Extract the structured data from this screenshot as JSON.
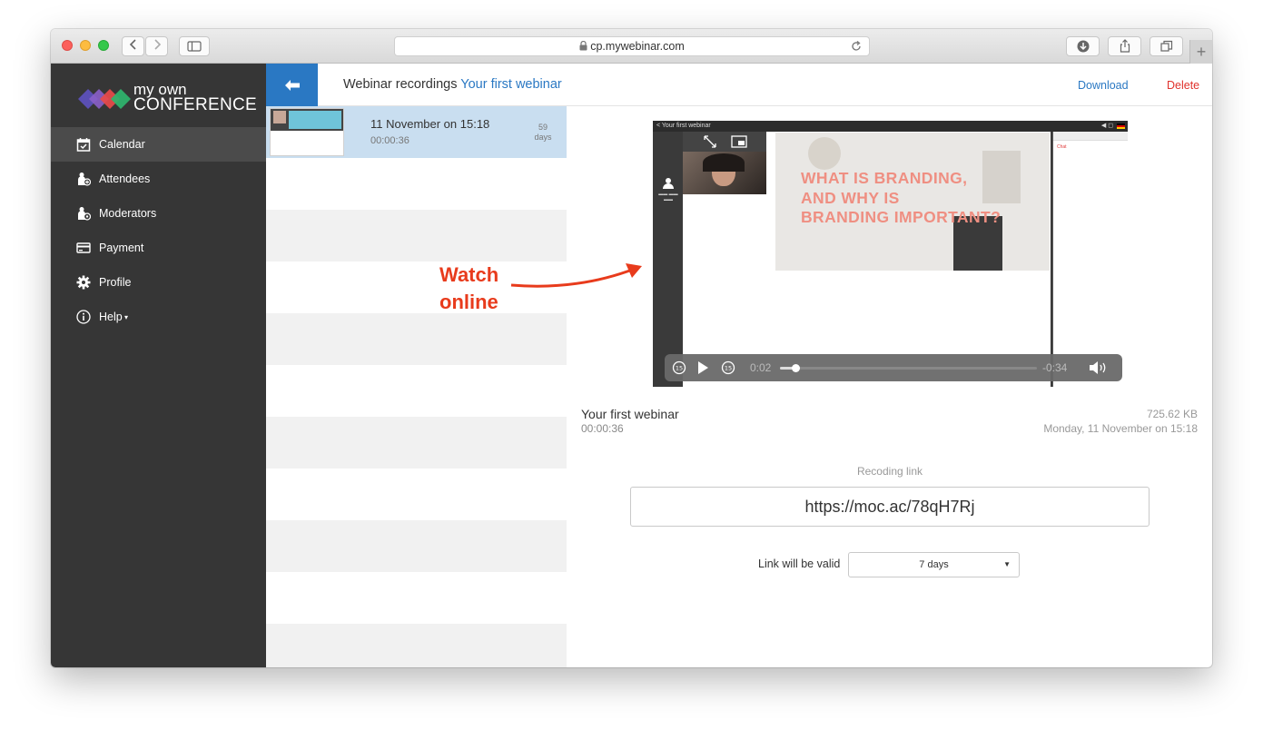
{
  "browser": {
    "url": "cp.mywebinar.com",
    "new_tab_glyph": "+"
  },
  "brand": {
    "line1": "my own",
    "line2": "CONFERENCE",
    "colors": [
      "#5a4fb3",
      "#8a5fc9",
      "#e84a4a",
      "#2fb56e"
    ]
  },
  "sidebar": {
    "items": [
      {
        "label": "Calendar",
        "icon": "calendar-check-icon",
        "active": true
      },
      {
        "label": "Attendees",
        "icon": "attendees-icon",
        "active": false
      },
      {
        "label": "Moderators",
        "icon": "moderator-icon",
        "active": false
      },
      {
        "label": "Payment",
        "icon": "credit-card-icon",
        "active": false
      },
      {
        "label": "Profile",
        "icon": "gear-icon",
        "active": false
      },
      {
        "label": "Help",
        "icon": "info-icon",
        "active": false,
        "has_dropdown": true
      }
    ]
  },
  "header": {
    "title": "Webinar recordings",
    "subtitle": "Your first webinar",
    "download_label": "Download",
    "delete_label": "Delete",
    "back_icon": "arrow-left-icon"
  },
  "recordings": [
    {
      "title": "11 November on 15:18",
      "duration": "00:00:36",
      "days_left": "59",
      "days_unit": "days",
      "selected": true
    }
  ],
  "player": {
    "top_title": "< Your first webinar",
    "slide_text": [
      "WHAT IS BRANDING,",
      "AND WHY IS",
      "BRANDING IMPORTANT?"
    ],
    "side_label": "Chat",
    "elapsed": "0:02",
    "remaining": "-0:34",
    "progress": 0.06
  },
  "details": {
    "title": "Your first webinar",
    "duration": "00:00:36",
    "size": "725.62 KB",
    "date": "Monday, 11 November on 15:18",
    "link_label": "Recoding link",
    "link": "https://moc.ac/78qH7Rj",
    "valid_label": "Link will be valid",
    "valid_value": "7 days"
  },
  "annotation": {
    "line1": "Watch",
    "line2": "online",
    "color": "#e83b1c"
  }
}
